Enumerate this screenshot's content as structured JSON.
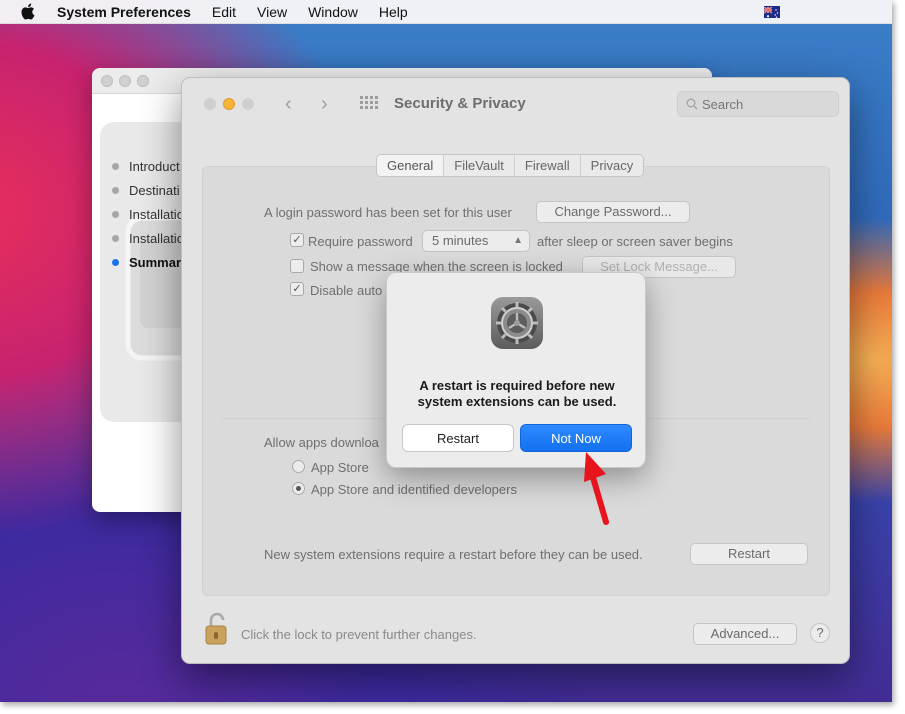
{
  "menubar": {
    "apple_icon": "apple-logo-icon",
    "app_name": "System Preferences",
    "items": [
      "Edit",
      "View",
      "Window",
      "Help"
    ],
    "flag_icon": "australia-flag-icon"
  },
  "installer": {
    "steps": [
      "Introduct",
      "Destinati",
      "Installatio",
      "Installatio",
      "Summar"
    ],
    "active_step": 4
  },
  "security": {
    "title": "Security & Privacy",
    "search_placeholder": "Search",
    "tabs": [
      "General",
      "FileVault",
      "Firewall",
      "Privacy"
    ],
    "selected_tab": "General",
    "login_password_text": "A login password has been set for this user",
    "change_password_label": "Change Password...",
    "require_password_label": "Require password",
    "require_password_value": "5 minutes",
    "after_sleep_text": "after sleep or screen saver begins",
    "show_message_label": "Show a message when the screen is locked",
    "set_lock_message_label": "Set Lock Message...",
    "disable_auto_label": "Disable auto",
    "allow_apps_text": "Allow apps downloa",
    "radio_app_store": "App Store",
    "radio_identified": "App Store and identified developers",
    "extensions_text": "New system extensions require a restart before they can be used.",
    "restart_label": "Restart",
    "lock_text": "Click the lock to prevent further changes.",
    "advanced_label": "Advanced...",
    "help_label": "?"
  },
  "dialog": {
    "icon": "system-preferences-gear-icon",
    "message_line1": "A restart is required before new",
    "message_line2": "system extensions can be used.",
    "restart_label": "Restart",
    "not_now_label": "Not Now"
  },
  "colors": {
    "accent_blue": "#1a73e8",
    "annotation_red": "#e8141c"
  }
}
